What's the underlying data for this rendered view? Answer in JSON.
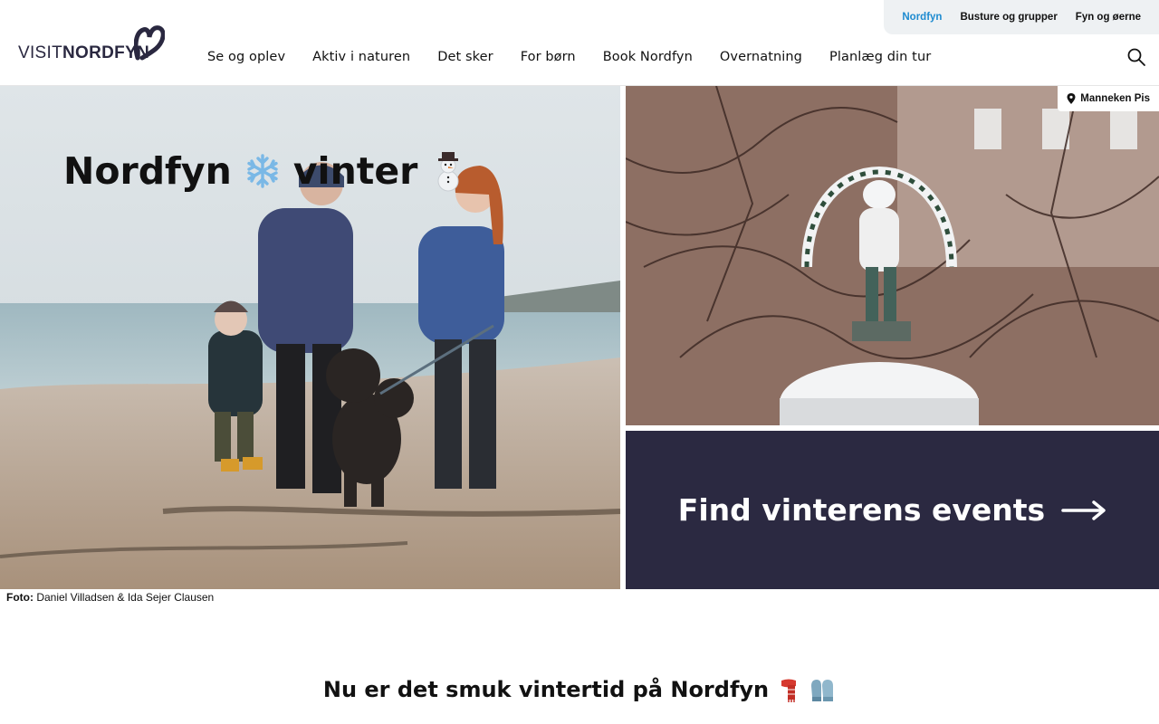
{
  "brand": {
    "logo_part1": "VISIT",
    "logo_part2": "NORDFYN",
    "accent_color": "#1e8bd0",
    "dark_color": "#2b2941"
  },
  "topbar": {
    "links": [
      {
        "label": "Nordfyn",
        "active": true
      },
      {
        "label": "Busture og grupper",
        "active": false
      },
      {
        "label": "Fyn og øerne",
        "active": false
      }
    ]
  },
  "nav": {
    "items": [
      {
        "label": "Se og oplev"
      },
      {
        "label": "Aktiv i naturen"
      },
      {
        "label": "Det sker"
      },
      {
        "label": "For børn"
      },
      {
        "label": "Book Nordfyn"
      },
      {
        "label": "Overnatning"
      },
      {
        "label": "Planlæg din tur"
      }
    ],
    "search_icon": "search-icon"
  },
  "hero": {
    "title_word1": "Nordfyn",
    "title_word2": "vinter",
    "title_icons": [
      "snowflake-icon",
      "snowman-icon"
    ],
    "location_label": "Manneken Pis",
    "cta_label": "Find vinterens events",
    "cta_icon": "arrow-right-icon"
  },
  "credit": {
    "prefix": "Foto:",
    "names": "Daniel Villadsen & Ida Sejer Clausen"
  },
  "section": {
    "title": "Nu er det smuk vintertid på Nordfyn",
    "title_icons": [
      "scarf-icon",
      "gloves-icon"
    ]
  }
}
